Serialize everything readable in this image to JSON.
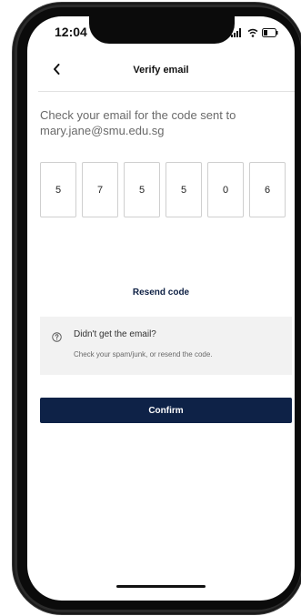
{
  "status_bar": {
    "time": "12:04",
    "icons": [
      "signal-icon",
      "wifi-icon",
      "battery-icon"
    ]
  },
  "header": {
    "back_icon": "chevron-left-icon",
    "title": "Verify email"
  },
  "instruction": {
    "line1": "Check your email for the code sent to",
    "email": "mary.jane@smu.edu.sg"
  },
  "otp": {
    "digits": [
      "5",
      "7",
      "5",
      "5",
      "0",
      "6"
    ]
  },
  "resend_label": "Resend code",
  "help": {
    "icon": "question-circle-icon",
    "title": "Didn't get the email?",
    "text": "Check your spam/junk, or resend the code."
  },
  "confirm_label": "Confirm",
  "colors": {
    "primary": "#0e2247",
    "help_bg": "#f2f2f2",
    "text_muted": "#6a6a6a"
  }
}
